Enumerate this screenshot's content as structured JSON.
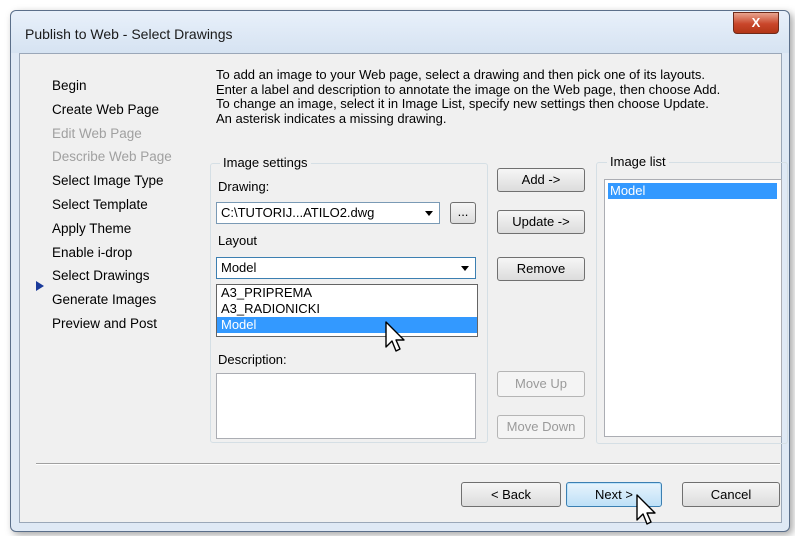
{
  "window": {
    "title": "Publish to Web - Select Drawings",
    "close_label": "X"
  },
  "nav": {
    "items": [
      {
        "label": "Begin",
        "state": "enabled"
      },
      {
        "label": "Create Web Page",
        "state": "enabled"
      },
      {
        "label": "Edit Web Page",
        "state": "disabled"
      },
      {
        "label": "Describe Web Page",
        "state": "disabled"
      },
      {
        "label": "Select Image Type",
        "state": "enabled"
      },
      {
        "label": "Select Template",
        "state": "enabled"
      },
      {
        "label": "Apply Theme",
        "state": "enabled"
      },
      {
        "label": "Enable i-drop",
        "state": "enabled"
      },
      {
        "label": "Select Drawings",
        "state": "current"
      },
      {
        "label": "Generate Images",
        "state": "enabled"
      },
      {
        "label": "Preview and Post",
        "state": "enabled"
      }
    ]
  },
  "instructions": {
    "line1": "To add an image to your Web page, select a drawing and then pick one of its layouts.",
    "line2": "Enter a label and description to annotate the image on the Web page, then choose Add.",
    "line3": "To change an image, select it in Image List, specify new settings then choose Update.",
    "line4": "An asterisk indicates a missing drawing."
  },
  "image_settings": {
    "group_label": "Image settings",
    "drawing_label": "Drawing:",
    "drawing_value": "C:\\TUTORIJ...ATILO2.dwg",
    "browse_label": "...",
    "layout_label": "Layout",
    "layout_value": "Model",
    "layout_options": [
      "A3_PRIPREMA",
      "A3_RADIONICKI",
      "Model"
    ],
    "description_label": "Description:"
  },
  "buttons": {
    "add": "Add ->",
    "update": "Update ->",
    "remove": "Remove",
    "move_up": "Move Up",
    "move_down": "Move Down",
    "back": "< Back",
    "next": "Next >",
    "cancel": "Cancel"
  },
  "image_list": {
    "label": "Image list",
    "items": [
      "Model"
    ]
  }
}
